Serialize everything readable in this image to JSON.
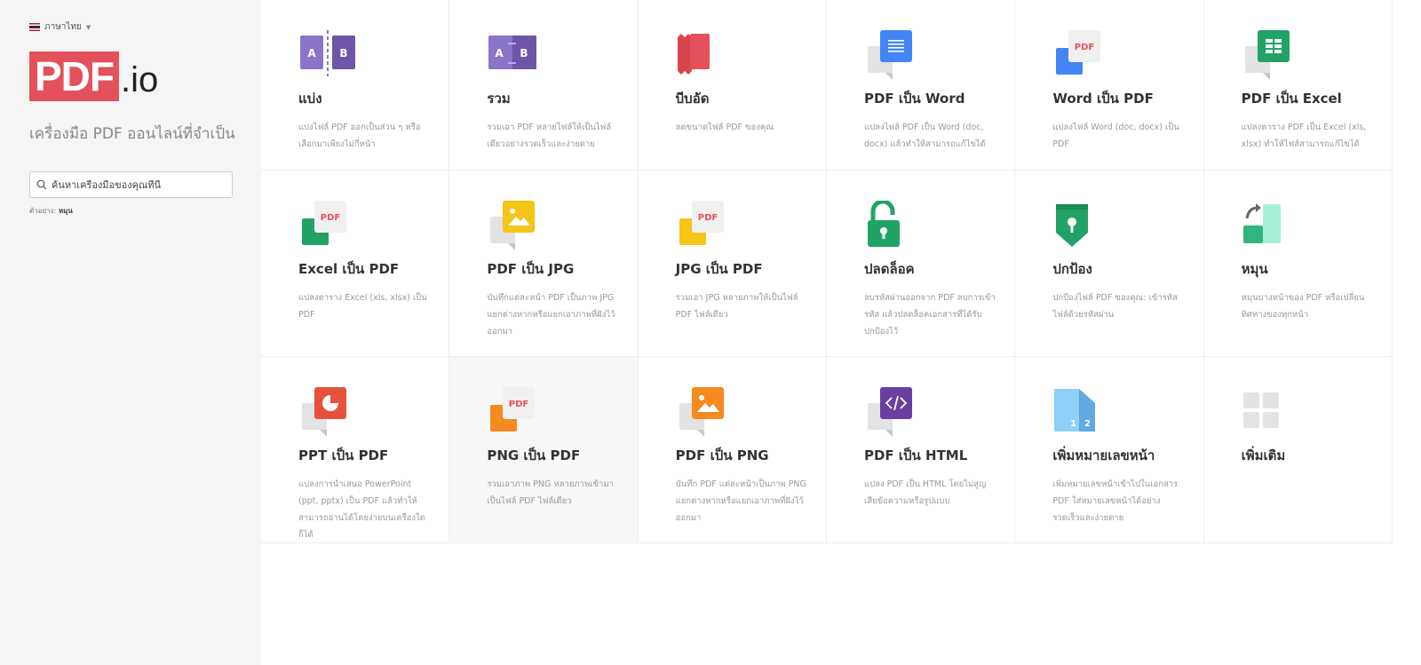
{
  "sidebar": {
    "language": "ภาษาไทย",
    "logo_main": "PDF",
    "logo_suffix": ".io",
    "tagline": "เครื่องมือ PDF ออนไลน์ที่จำเป็น",
    "search_placeholder": "ค้นหาเครื่องมือของคุณที่นี่",
    "example_label": "ตัวอย่าง:",
    "example_value": "หมุน"
  },
  "tools": [
    {
      "icon": "split-icon",
      "title": "แบ่ง",
      "desc": "แบ่งไฟล์ PDF ออกเป็นส่วน ๆ หรือเลือกมาเพียงไม่กี่หน้า"
    },
    {
      "icon": "merge-icon",
      "title": "รวม",
      "desc": "รวมเอา PDF หลายไฟล์ให้เป็นไฟล์เดียวอย่างรวดเร็วและง่ายดาย"
    },
    {
      "icon": "compress-icon",
      "title": "บีบอัด",
      "desc": "ลดขนาดไฟล์ PDF ของคุณ"
    },
    {
      "icon": "pdf-to-word-icon",
      "title": "PDF เป็น Word",
      "desc": "แปลงไฟล์ PDF เป็น Word (doc, docx) แล้วทำให้สามารถแก้ไขได้"
    },
    {
      "icon": "word-to-pdf-icon",
      "title": "Word เป็น PDF",
      "desc": "แปลงไฟล์ Word (doc, docx) เป็น PDF"
    },
    {
      "icon": "pdf-to-excel-icon",
      "title": "PDF เป็น Excel",
      "desc": "แปลงตาราง PDF เป็น Excel (xls, xlsx) ทำให้ไฟล์สามารถแก้ไขได้"
    },
    {
      "icon": "excel-to-pdf-icon",
      "title": "Excel เป็น PDF",
      "desc": "แปลงตาราง Excel (xls, xlsx) เป็น PDF"
    },
    {
      "icon": "pdf-to-jpg-icon",
      "title": "PDF เป็น JPG",
      "desc": "บันทึกแต่ละหน้า PDF เป็นภาพ JPG แยกต่างหากหรือแยกเอาภาพที่ฝังไว้ออกมา"
    },
    {
      "icon": "jpg-to-pdf-icon",
      "title": "JPG เป็น PDF",
      "desc": "รวมเอา JPG หลายภาพให้เป็นไฟล์ PDF ไฟล์เดียว"
    },
    {
      "icon": "unlock-icon",
      "title": "ปลดล็อค",
      "desc": "ลบรหัสผ่านออกจาก PDF ลบการเข้ารหัส แล้วปลดล็อคเอกสารที่ได้รับปกป้องไว้"
    },
    {
      "icon": "protect-icon",
      "title": "ปกป้อง",
      "desc": "ปกป้องไฟล์ PDF ของคุณ: เข้ารหัสไฟล์ด้วยรหัสผ่าน"
    },
    {
      "icon": "rotate-icon",
      "title": "หมุน",
      "desc": "หมุนบางหน้าของ PDF หรือเปลี่ยนทิศทางของทุกหน้า"
    },
    {
      "icon": "ppt-to-pdf-icon",
      "title": "PPT เป็น PDF",
      "desc": "แปลงการนำเสนอ PowerPoint (ppt, pptx) เป็น PDF แล้วทำให้สามารถอ่านได้โดยง่ายบนเครื่องใดก็ได้"
    },
    {
      "icon": "png-to-pdf-icon",
      "title": "PNG เป็น PDF",
      "desc": "รวมเอาภาพ PNG หลายภาพเข้ามาเป็นไฟล์ PDF ไฟล์เดียว",
      "hover": true
    },
    {
      "icon": "pdf-to-png-icon",
      "title": "PDF เป็น PNG",
      "desc": "บันทึก PDF แต่ละหน้าเป็นภาพ PNG แยกต่างหากหรือแยกเอาภาพที่ฝังไว้ออกมา"
    },
    {
      "icon": "pdf-to-html-icon",
      "title": "PDF เป็น HTML",
      "desc": "แปลง PDF เป็น HTML โดยไม่สูญเสียข้อความหรือรูปแบบ"
    },
    {
      "icon": "page-numbers-icon",
      "title": "เพิ่มหมายเลขหน้า",
      "desc": "เพิ่มหมายเลขหน้าเข้าไปในเอกสาร PDF ใส่หมายเลขหน้าได้อย่างรวดเร็วและง่ายดาย"
    },
    {
      "icon": "more-icon",
      "title": "เพิ่มเติม",
      "desc": ""
    }
  ],
  "colors": {
    "brand": "#e5515a",
    "purple": "#8a74c8",
    "blue": "#4285f4",
    "green": "#21a366",
    "yellow": "#f5c518",
    "orange": "#f58a1f",
    "pink": "#e5515a"
  }
}
